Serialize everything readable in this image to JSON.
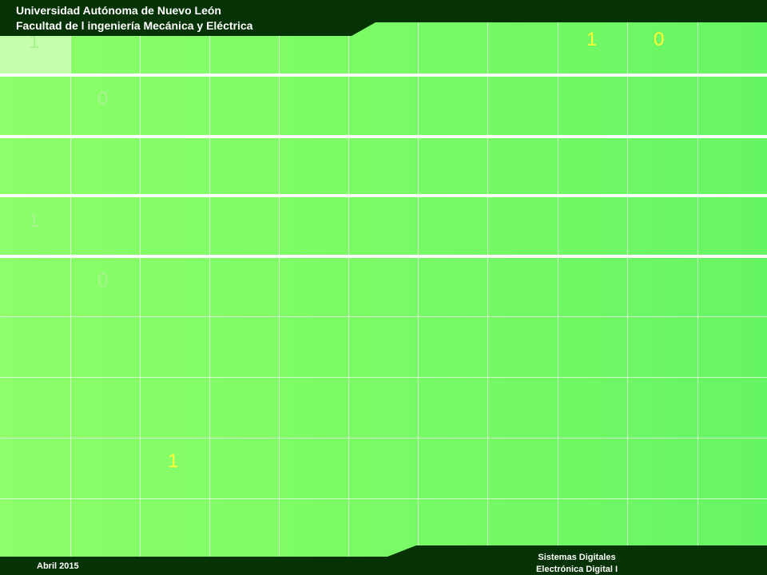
{
  "header": {
    "line1": "Universidad Autónoma de Nuevo León",
    "line2": "Facultad de l ingeniería Mecánica y Eléctrica"
  },
  "footer": {
    "date": "Abril 2015",
    "course_line1": "Sistemas Digitales",
    "course_line2": "Electrónica Digital I"
  },
  "digits": [
    {
      "text": "1",
      "color": "#a8f48c"
    },
    {
      "text": "1",
      "color": "#ffff33"
    },
    {
      "text": "0",
      "color": "#ffff33"
    },
    {
      "text": "0",
      "color": "#a8f48c"
    },
    {
      "text": "1",
      "color": "#a8f48c"
    },
    {
      "text": "0",
      "color": "#a8f48c"
    },
    {
      "text": "1",
      "color": "#ffff33"
    }
  ],
  "colors": {
    "dark_green": "#053305",
    "light_cell": "#c4ffac"
  }
}
